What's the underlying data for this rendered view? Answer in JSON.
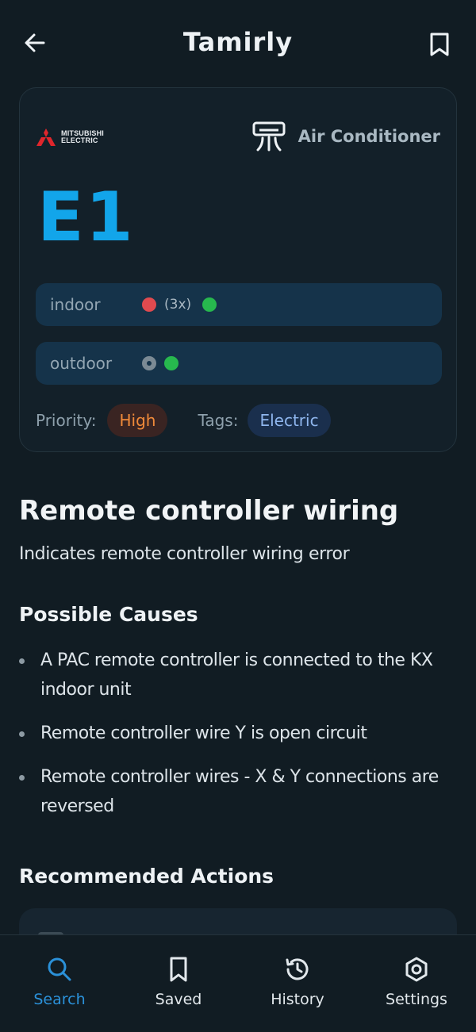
{
  "header": {
    "title": "Tamirly"
  },
  "card": {
    "brand": {
      "line1": "MITSUBISHI",
      "line2": "ELECTRIC"
    },
    "appliance": "Air Conditioner",
    "code": "E1",
    "indoor": {
      "label": "indoor",
      "blink_count": "(3x)",
      "indicators": [
        "red-blinking",
        "green-on"
      ]
    },
    "outdoor": {
      "label": "outdoor",
      "indicators": [
        "gray-off",
        "green-on"
      ]
    },
    "priority_label": "Priority:",
    "priority_value": "High",
    "tags_label": "Tags:",
    "tags": [
      "Electric"
    ]
  },
  "error": {
    "title": "Remote controller wiring",
    "description": "Indicates remote controller wiring error"
  },
  "causes": {
    "heading": "Possible Causes",
    "items": [
      "A PAC remote controller is connected to the KX indoor unit",
      "Remote controller wire Y is open circuit",
      "Remote controller wires - X & Y connections are reversed"
    ]
  },
  "actions": {
    "heading": "Recommended Actions"
  },
  "nav": {
    "items": [
      {
        "label": "Search",
        "icon": "search-icon",
        "active": true
      },
      {
        "label": "Saved",
        "icon": "bookmark-icon",
        "active": false
      },
      {
        "label": "History",
        "icon": "history-icon",
        "active": false
      },
      {
        "label": "Settings",
        "icon": "settings-icon",
        "active": false
      }
    ]
  },
  "colors": {
    "background": "#111c23",
    "accent": "#12a5ea",
    "nav_active": "#2b91d9",
    "priority": "#f08a3a",
    "tag": "#8fb6ee",
    "led_red": "#e04a4f",
    "led_green": "#27b84e"
  }
}
